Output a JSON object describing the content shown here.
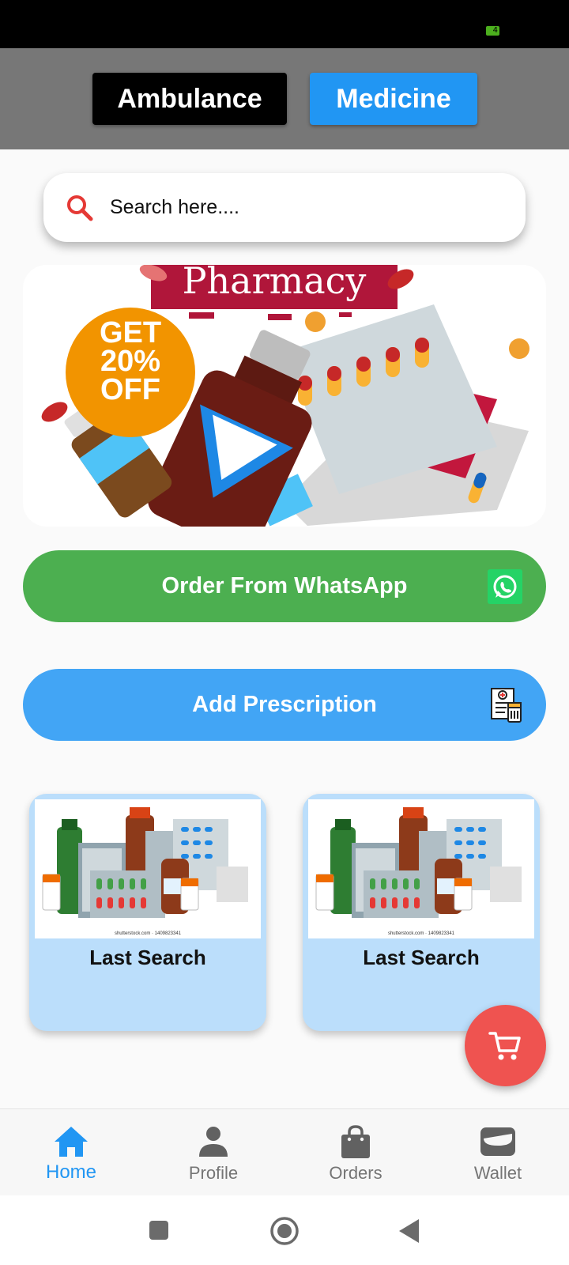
{
  "status_bar": {
    "battery_label": "4"
  },
  "top_tabs": {
    "ambulance_label": "Ambulance",
    "medicine_label": "Medicine"
  },
  "search": {
    "placeholder": "Search here...."
  },
  "banner": {
    "title": "Pharmacy",
    "badge_line1": "GET",
    "badge_line2": "20%",
    "badge_line3": "OFF"
  },
  "actions": {
    "whatsapp_label": "Order From WhatsApp",
    "prescription_label": "Add Prescription"
  },
  "cards": [
    {
      "title": "Last Search",
      "watermark": "shutterstock.com · 1409823341"
    },
    {
      "title": "Last Search",
      "watermark": "shutterstock.com · 1409823341"
    }
  ],
  "bottom_nav": {
    "items": [
      {
        "label": "Home",
        "icon": "home-icon",
        "active": true
      },
      {
        "label": "Profile",
        "icon": "person-icon",
        "active": false
      },
      {
        "label": "Orders",
        "icon": "shopping-bag-icon",
        "active": false
      },
      {
        "label": "Wallet",
        "icon": "wallet-icon",
        "active": false
      }
    ]
  },
  "colors": {
    "accent_blue": "#2196f3",
    "whatsapp_green": "#4caf50",
    "prescription_blue": "#42a5f5",
    "cart_red": "#ef5350",
    "card_bg": "#bbdefb"
  }
}
